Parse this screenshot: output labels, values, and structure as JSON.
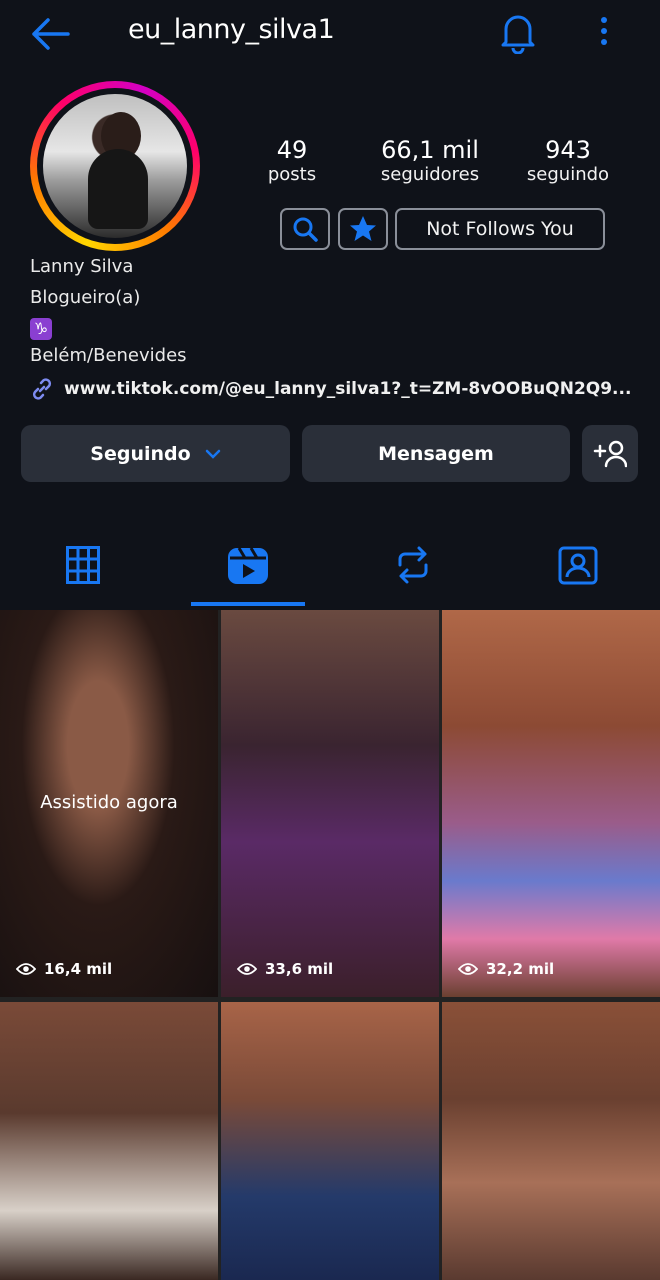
{
  "header": {
    "username": "eu_lanny_silva1"
  },
  "stats": [
    {
      "value": "49",
      "label": "posts"
    },
    {
      "value": "66,1 mil",
      "label": "seguidores"
    },
    {
      "value": "943",
      "label": "seguindo"
    }
  ],
  "relation_label": "Not Follows You",
  "bio": {
    "name": "Lanny Silva",
    "category": "Blogueiro(a)",
    "emoji": "♑",
    "location": "Belém/Benevides",
    "link": "www.tiktok.com/@eu_lanny_silva1?_t=ZM-8vOOBuQN2Q9..."
  },
  "actions": {
    "following": "Seguindo",
    "message": "Mensagem"
  },
  "tabs": [
    "grid",
    "reels",
    "reposts",
    "tagged"
  ],
  "reels": [
    {
      "views": "16,4 mil",
      "overlay": "Assistido agora"
    },
    {
      "views": "33,6 mil"
    },
    {
      "views": "32,2 mil"
    },
    {
      "views": ""
    },
    {
      "views": ""
    },
    {
      "views": ""
    }
  ],
  "colors": {
    "accent": "#1877f2",
    "background": "#0f1219",
    "button": "#2a2f39"
  }
}
